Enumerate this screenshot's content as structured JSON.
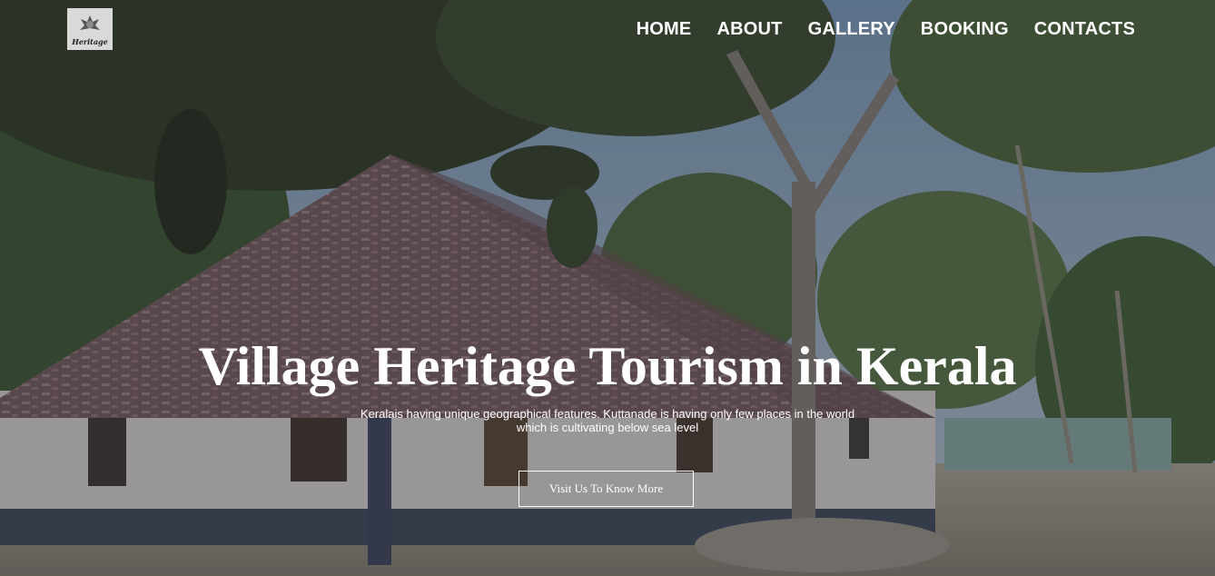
{
  "logo": {
    "text": "Heritage",
    "alt": "Heritage logo"
  },
  "nav": {
    "items": [
      "HOME",
      "ABOUT",
      "GALLERY",
      "BOOKING",
      "CONTACTS"
    ]
  },
  "hero": {
    "title": "Village Heritage Tourism in Kerala",
    "description": "Keralais having unique geographical features. Kuttanade is having only few places in the world which is cultivating below sea level",
    "button_label": "Visit Us To Know More",
    "image_icon": "heritage-house-photo"
  },
  "colors": {
    "text": "#ffffff",
    "logo_bg": "#d9d9d9"
  }
}
